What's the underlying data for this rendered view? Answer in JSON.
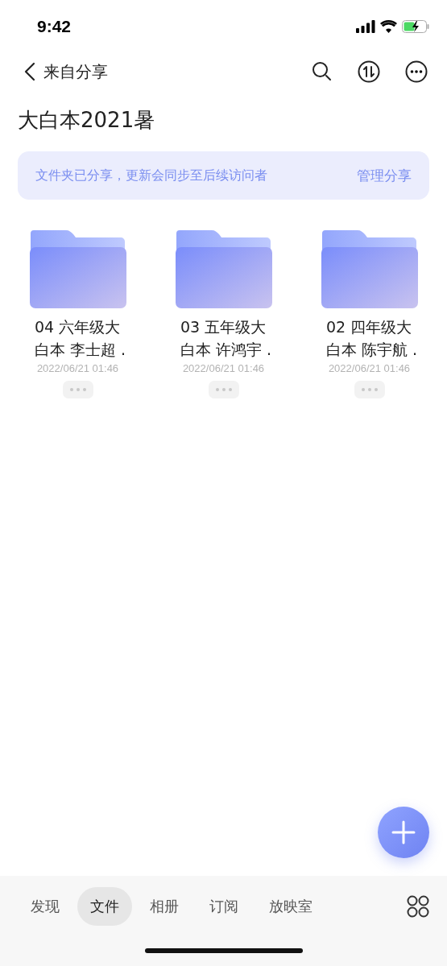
{
  "status_bar": {
    "time": "9:42"
  },
  "nav": {
    "back_label": "来自分享"
  },
  "title": "大白本2021暑",
  "banner": {
    "message": "文件夹已分享，更新会同步至后续访问者",
    "action": "管理分享"
  },
  "folders": [
    {
      "name_lines": [
        "04 六年级大",
        "白本 李士超 ."
      ],
      "date": "2022/06/21 01:46"
    },
    {
      "name_lines": [
        "03 五年级大",
        "白本 许鸿宇 ."
      ],
      "date": "2022/06/21 01:46"
    },
    {
      "name_lines": [
        "02 四年级大",
        "白本 陈宇航 ."
      ],
      "date": "2022/06/21 01:46"
    }
  ],
  "tabs": [
    {
      "label": "发现",
      "selected": false
    },
    {
      "label": "文件",
      "selected": true
    },
    {
      "label": "相册",
      "selected": false
    },
    {
      "label": "订阅",
      "selected": false
    },
    {
      "label": "放映室",
      "selected": false
    }
  ]
}
